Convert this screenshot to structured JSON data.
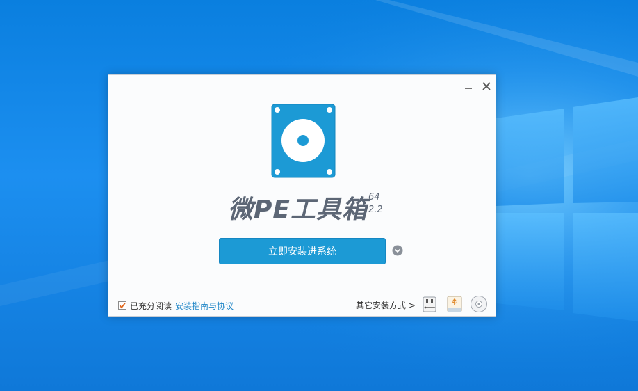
{
  "desktop": {
    "accent_color": "#0a7fdf",
    "light_color": "#4db4f7"
  },
  "window": {
    "title_icon": "disk-icon",
    "minimize_icon": "minimize-icon",
    "close_icon": "close-icon"
  },
  "app": {
    "name": "微PE工具箱",
    "arch": "64",
    "version": "2.2",
    "logo_color": "#1c9ad5"
  },
  "main": {
    "install_button_label": "立即安装进系统",
    "dropdown_icon": "chevron-down-icon"
  },
  "footer": {
    "agree_checked": true,
    "agree_label": "已充分阅读",
    "agree_link": "安装指南与协议",
    "other_methods_label": "其它安装方式 >",
    "methods": [
      {
        "icon": "usb-drive-icon"
      },
      {
        "icon": "portable-disk-icon"
      },
      {
        "icon": "iso-disc-icon"
      }
    ]
  }
}
